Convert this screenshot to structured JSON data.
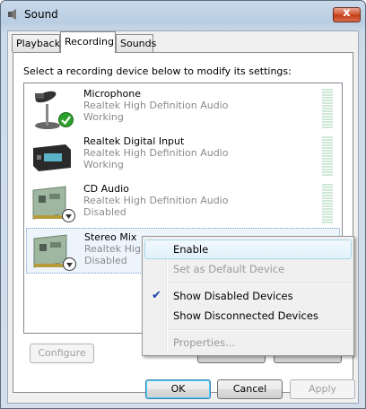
{
  "window": {
    "title": "Sound",
    "close_label": "x"
  },
  "tabs": [
    {
      "label": "Playback",
      "active": false
    },
    {
      "label": "Recording",
      "active": true
    },
    {
      "label": "Sounds",
      "active": false
    }
  ],
  "instruction": "Select a recording device below to modify its settings:",
  "devices": [
    {
      "name": "Microphone",
      "driver": "Realtek High Definition Audio",
      "status": "Working",
      "icon": "microphone-icon",
      "badge": "default-check"
    },
    {
      "name": "Realtek Digital Input",
      "driver": "Realtek High Definition Audio",
      "status": "Working",
      "icon": "digital-input-icon",
      "badge": ""
    },
    {
      "name": "CD Audio",
      "driver": "Realtek High Definition Audio",
      "status": "Disabled",
      "icon": "sound-card-icon",
      "badge": "disabled-arrow"
    },
    {
      "name": "Stereo Mix",
      "driver": "Realtek High",
      "status": "Disabled",
      "icon": "sound-card-icon",
      "badge": "disabled-arrow"
    }
  ],
  "buttons": {
    "configure": "Configure",
    "ok": "OK",
    "cancel": "Cancel",
    "apply": "Apply"
  },
  "context_menu": {
    "items": [
      {
        "label": "Enable",
        "state": "highlighted"
      },
      {
        "label": "Set as Default Device",
        "state": "disabled"
      },
      {
        "label": "Show Disabled Devices",
        "state": "checked"
      },
      {
        "label": "Show Disconnected Devices",
        "state": "normal"
      },
      {
        "label": "Properties...",
        "state": "disabled"
      }
    ]
  },
  "colors": {
    "accent": "#3399ff",
    "check_green": "#2ca02c",
    "disabled_text": "#8a8a8a"
  }
}
